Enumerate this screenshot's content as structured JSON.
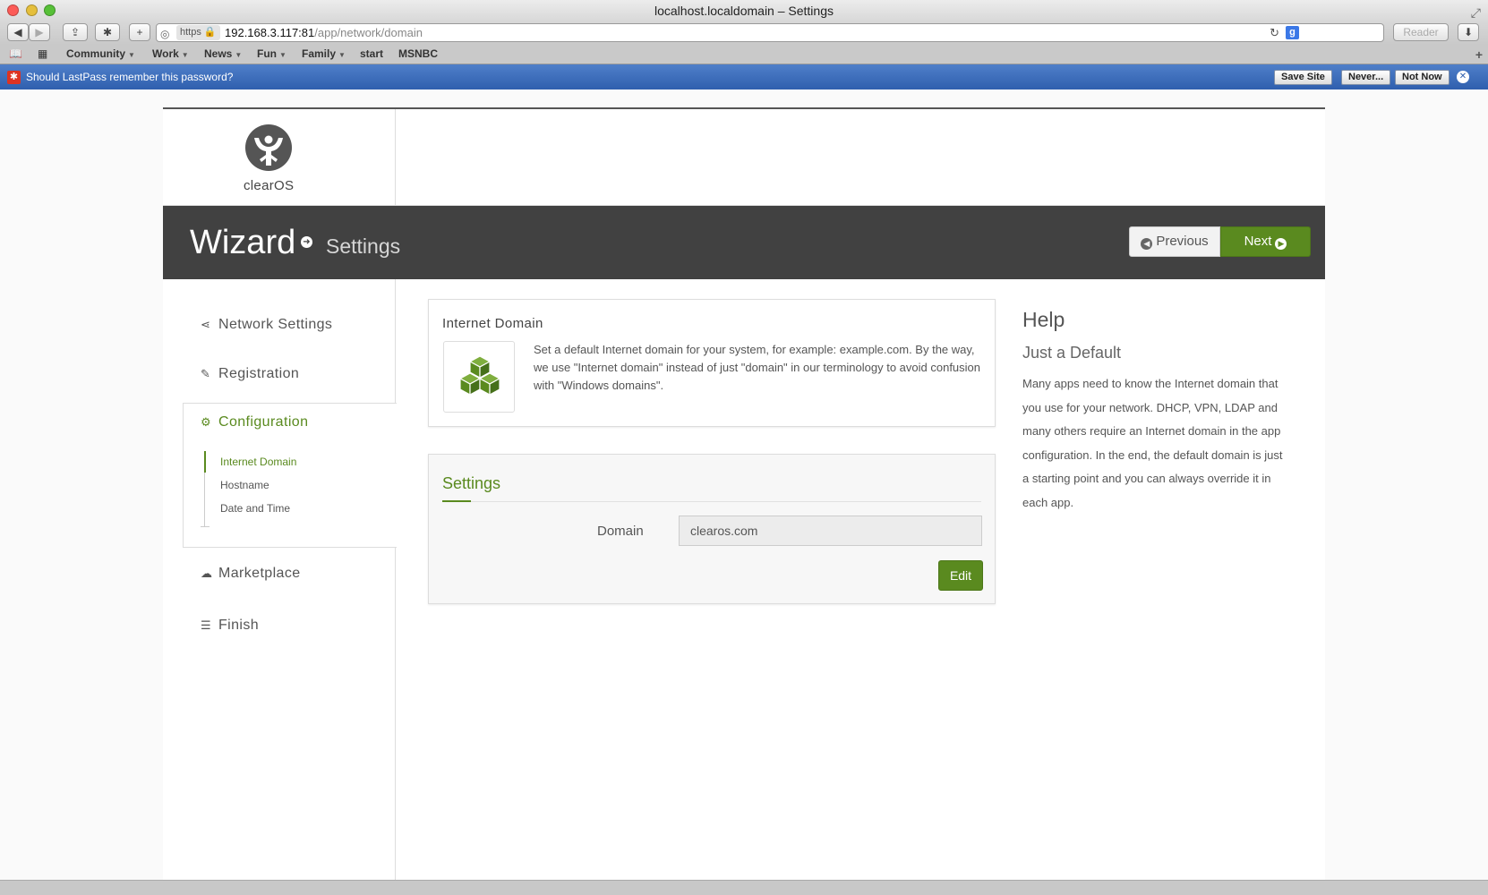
{
  "window": {
    "title": "localhost.localdomain – Settings"
  },
  "toolbar": {
    "url_scheme": "https",
    "url_host": "192.168.3.117:81",
    "url_path": "/app/network/domain",
    "reader_label": "Reader"
  },
  "bookmarks": [
    {
      "label": "Community",
      "has_menu": true
    },
    {
      "label": "Work",
      "has_menu": true
    },
    {
      "label": "News",
      "has_menu": true
    },
    {
      "label": "Fun",
      "has_menu": true
    },
    {
      "label": "Family",
      "has_menu": true
    },
    {
      "label": "start",
      "has_menu": false
    },
    {
      "label": "MSNBC",
      "has_menu": false
    }
  ],
  "lastpass": {
    "message": "Should LastPass remember this password?",
    "save_site": "Save Site",
    "never": "Never...",
    "not_now": "Not Now"
  },
  "brand": {
    "logo_text": "clearOS"
  },
  "banner": {
    "title": "Wizard",
    "subtitle": "Settings",
    "previous": "Previous",
    "next": "Next"
  },
  "nav": {
    "network": "Network Settings",
    "registration": "Registration",
    "configuration": "Configuration",
    "sub_items": [
      "Internet Domain",
      "Hostname",
      "Date and Time"
    ],
    "marketplace": "Marketplace",
    "finish": "Finish"
  },
  "domain_panel": {
    "title": "Internet Domain",
    "description": "Set a default Internet domain for your system, for example: example.com. By the way, we use \"Internet domain\" instead of just \"domain\" in our terminology to avoid confusion with \"Windows domains\"."
  },
  "settings_panel": {
    "title": "Settings",
    "domain_label": "Domain",
    "domain_value": "clearos.com",
    "edit_label": "Edit"
  },
  "help": {
    "title": "Help",
    "subtitle": "Just a Default",
    "text": "Many apps need to know the Internet domain that you use for your network. DHCP, VPN, LDAP and many others require an Internet domain in the app configuration. In the end, the default domain is just a starting point and you can always override it in each app."
  },
  "colors": {
    "accent": "#5a8a1f",
    "banner": "#414141",
    "lastpass_bar": "#3f6fbc"
  }
}
